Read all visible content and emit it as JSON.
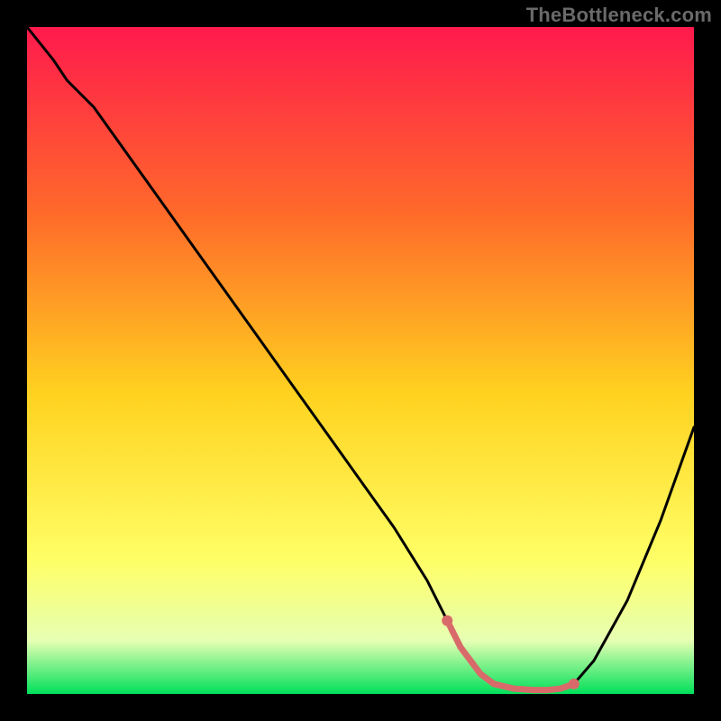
{
  "watermark": "TheBottleneck.com",
  "colors": {
    "frame": "#000000",
    "gradient_top": "#ff1a4d",
    "gradient_mid1": "#ff6a2a",
    "gradient_mid2": "#ffd21f",
    "gradient_mid3": "#ffff66",
    "gradient_mid4": "#e6ffb3",
    "gradient_bottom": "#00e05a",
    "curve": "#000000",
    "highlight": "#d96a6a"
  },
  "chart_data": {
    "type": "line",
    "title": "",
    "xlabel": "",
    "ylabel": "",
    "xlim": [
      0,
      100
    ],
    "ylim": [
      0,
      100
    ],
    "series": [
      {
        "name": "curve",
        "x": [
          0,
          4,
          6,
          10,
          15,
          20,
          25,
          30,
          35,
          40,
          45,
          50,
          55,
          60,
          63,
          65,
          68,
          70,
          73,
          76,
          78,
          80,
          82,
          85,
          90,
          95,
          100
        ],
        "y": [
          100,
          95,
          92,
          88,
          81,
          74,
          67,
          60,
          53,
          46,
          39,
          32,
          25,
          17,
          11,
          7,
          3,
          1.5,
          0.8,
          0.6,
          0.6,
          0.8,
          1.5,
          5,
          14,
          26,
          40
        ]
      }
    ],
    "highlight_segment": {
      "series": "curve",
      "x_start": 63,
      "x_end": 82,
      "points_x": [
        63,
        65,
        68,
        70,
        73,
        76,
        78,
        80,
        82
      ],
      "points_y": [
        11,
        7,
        3,
        1.5,
        0.8,
        0.6,
        0.6,
        0.8,
        1.5
      ]
    }
  }
}
